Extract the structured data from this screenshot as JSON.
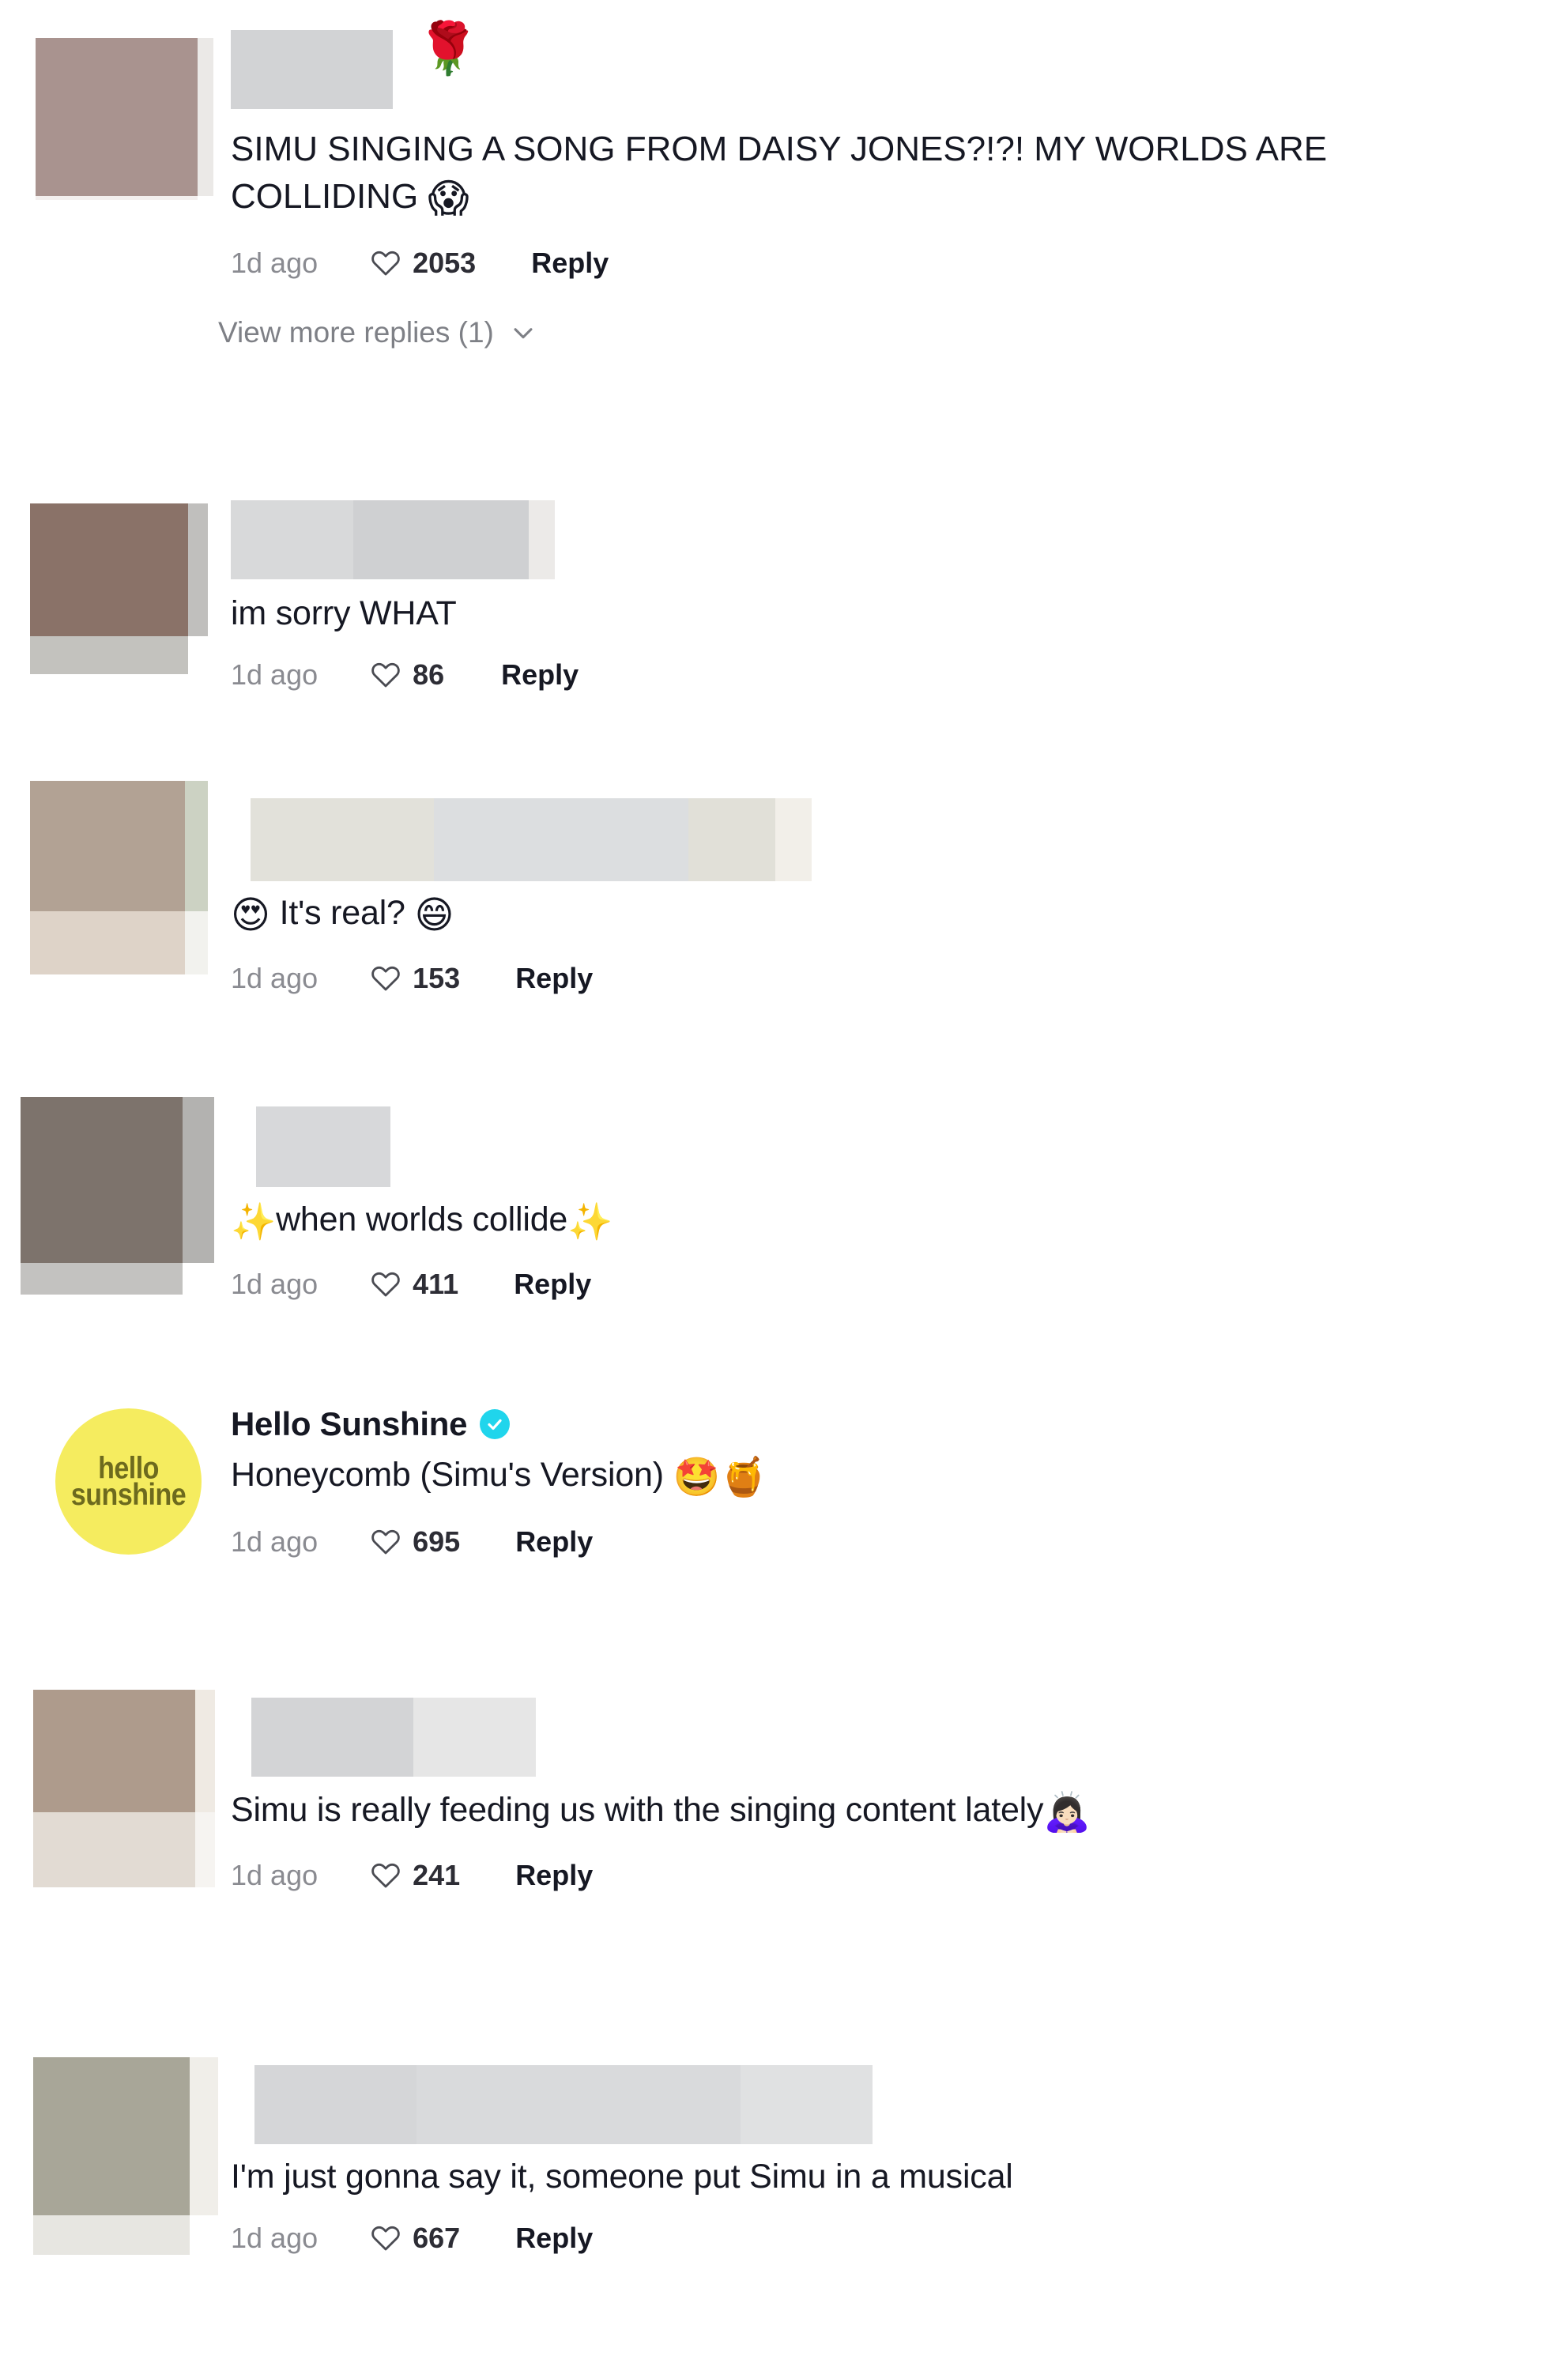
{
  "meta": {
    "like_icon": "heart-icon",
    "chevron_icon": "chevron-down-icon",
    "verified_icon": "verified-check-icon",
    "accent_verified": "#20d5ec",
    "text_color": "#161823",
    "muted_color": "#8a8b91"
  },
  "comments": [
    {
      "id": "c1",
      "username_hidden": true,
      "avatar_color": "#a9938f",
      "text": "SIMU SINGING A SONG FROM DAISY JONES?!?! MY WORLDS ARE COLLIDING ",
      "emoji_after": "😱",
      "emoji_before": "",
      "name_suffix_emoji": "🌹",
      "time": "1d ago",
      "likes": "2053",
      "reply_label": "Reply",
      "view_more_label": "View more replies (1)"
    },
    {
      "id": "c2",
      "username_hidden": true,
      "avatar_color": "#8a7268",
      "text": "im sorry WHAT",
      "emoji_after": "",
      "emoji_before": "",
      "name_suffix_emoji": "",
      "time": "1d ago",
      "likes": "86",
      "reply_label": "Reply"
    },
    {
      "id": "c3",
      "username_hidden": true,
      "avatar_color": "#b2a294",
      "text": " It's real? ",
      "emoji_before": "😍",
      "emoji_after": "😄",
      "name_suffix_emoji": "",
      "time": "1d ago",
      "likes": "153",
      "reply_label": "Reply"
    },
    {
      "id": "c4",
      "username_hidden": true,
      "avatar_color": "#7d736c",
      "text": "when worlds collide",
      "emoji_before": "✨",
      "emoji_after": "✨",
      "name_suffix_emoji": "",
      "time": "1d ago",
      "likes": "411",
      "reply_label": "Reply"
    },
    {
      "id": "c5",
      "username_hidden": false,
      "username": "Hello Sunshine",
      "verified": true,
      "avatar_logo_line1": "hello",
      "avatar_logo_line2": "sunshine",
      "avatar_color": "#f5ec5f",
      "avatar_logo_color": "#6d6a1e",
      "text": "Honeycomb (Simu's Version) ",
      "emoji_before": "",
      "emoji_after": "🤩🍯",
      "name_suffix_emoji": "",
      "time": "1d ago",
      "likes": "695",
      "reply_label": "Reply"
    },
    {
      "id": "c6",
      "username_hidden": true,
      "avatar_color": "#ae9b8c",
      "text": "Simu is really feeding us with the singing content lately",
      "emoji_before": "",
      "emoji_after": "🙇🏻‍♀️",
      "name_suffix_emoji": "",
      "time": "1d ago",
      "likes": "241",
      "reply_label": "Reply"
    },
    {
      "id": "c7",
      "username_hidden": true,
      "avatar_color": "#a8a698",
      "text": "I'm just gonna say it, someone put Simu in a musical",
      "emoji_before": "",
      "emoji_after": "",
      "name_suffix_emoji": "",
      "time": "1d ago",
      "likes": "667",
      "reply_label": "Reply"
    }
  ]
}
